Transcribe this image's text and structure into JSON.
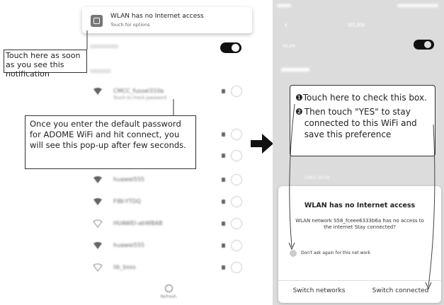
{
  "notification": {
    "title": "WLAN has no Internet access",
    "subtitle": "Touch for options"
  },
  "left_phone": {
    "refresh_label": "Refresh",
    "networks": [
      {
        "name": "CMCC_fussel310a",
        "sub": "Touch to check password"
      },
      {
        "name": "huawei555",
        "sub": ""
      },
      {
        "name": "FIBI-YTDQ",
        "sub": ""
      },
      {
        "name": "HUAWEI-abWBAB",
        "sub": ""
      },
      {
        "name": "huawei555",
        "sub": ""
      },
      {
        "name": "lib_boss",
        "sub": ""
      }
    ]
  },
  "callouts": {
    "touch_here": "Touch here as soon as you see this notification",
    "once_enter": "Once you enter the default password for ADOME WiFi and hit connect, you will see this pop-up after few seconds.",
    "step1": "Touch here to check this box.",
    "step2": "Then touch \"YES\" to stay connected to this WiFi and save this preference",
    "step1_marker": "❶",
    "step2_marker": "❷"
  },
  "right_phone": {
    "header_title": "WLAN",
    "wlan_label": "WLAN",
    "network_item": "CMCC-0078"
  },
  "dialog": {
    "title": "WLAN has no Internet access",
    "message": "WLAN network S58_fceee6333b6a has no access to the internet Stay connected?",
    "checkbox_label": "Don't ask again for this net work",
    "button_left": "Switch networks",
    "button_right": "Switch connected"
  }
}
